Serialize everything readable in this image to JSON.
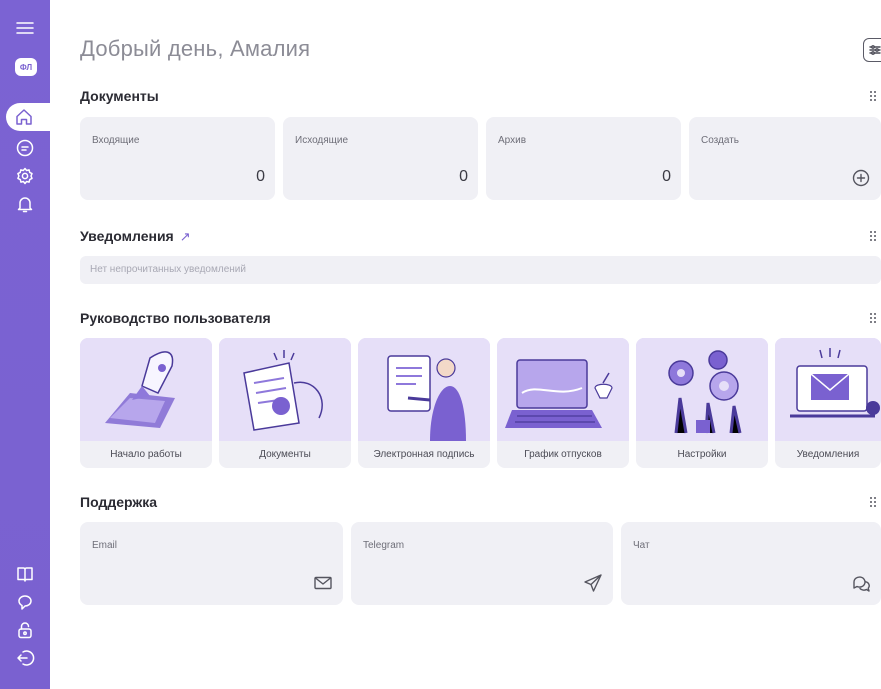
{
  "sidebar": {
    "avatar_text": "ФЛ",
    "top_icons": [
      "menu-icon",
      "home-icon",
      "document-icon",
      "settings-icon",
      "bell-icon"
    ],
    "bottom_icons": [
      "book-icon",
      "support-icon",
      "lock-icon",
      "logout-icon"
    ],
    "accent": "#7a61d0"
  },
  "header": {
    "greeting": "Добрый день, Амалия"
  },
  "documents": {
    "title": "Документы",
    "cards": [
      {
        "label": "Входящие",
        "count": "0"
      },
      {
        "label": "Исходящие",
        "count": "0"
      },
      {
        "label": "Архив",
        "count": "0"
      },
      {
        "label": "Создать"
      }
    ]
  },
  "notifications": {
    "title": "Уведомления",
    "arrow": "↗",
    "empty_text": "Нет непрочитанных уведомлений"
  },
  "guide": {
    "title": "Руководство пользователя",
    "items": [
      {
        "label": "Начало работы"
      },
      {
        "label": "Документы"
      },
      {
        "label": "Электронная подпись"
      },
      {
        "label": "График отпусков"
      },
      {
        "label": "Настройки"
      },
      {
        "label": "Уведомления"
      }
    ]
  },
  "support": {
    "title": "Поддержка",
    "cards": [
      {
        "label": "Email",
        "icon": "mail-icon"
      },
      {
        "label": "Telegram",
        "icon": "send-icon"
      },
      {
        "label": "Чат",
        "icon": "chat-icon"
      }
    ]
  }
}
